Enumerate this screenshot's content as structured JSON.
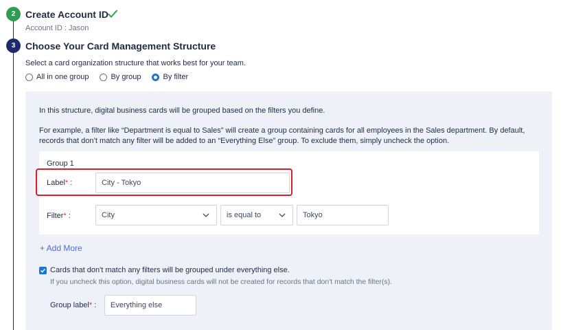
{
  "steps": [
    {
      "number": "2",
      "title": "Create Account ID",
      "status": "complete",
      "detail": "Account ID : Jason"
    },
    {
      "number": "3",
      "title": "Choose Your Card Management Structure",
      "status": "active",
      "description": "Select a card organization structure that works best for your team."
    }
  ],
  "structure_options": [
    {
      "label": "All in one group",
      "selected": false
    },
    {
      "label": "By group",
      "selected": false
    },
    {
      "label": "By filter",
      "selected": true
    }
  ],
  "filter_panel": {
    "intro": "In this structure, digital business cards will be grouped based on the filters you define.",
    "example": "For example, a filter like “Department is equal to Sales” will create a group containing cards for all employees in the Sales department. By default, records that don’t match any filter will be added to an “Everything Else” group. To exclude them, simply uncheck the option.",
    "group": {
      "title": "Group 1",
      "label_field": {
        "label": "Label",
        "required_mark": "*",
        "separator": ":",
        "value": "City - Tokyo"
      },
      "filter_field": {
        "label": "Filter",
        "required_mark": "*",
        "separator": ":",
        "attribute": "City",
        "operator": "is equal to",
        "value": "Tokyo"
      }
    },
    "add_more": "+ Add More",
    "everything_else": {
      "checked": true,
      "label": "Cards that don't match any filters will be grouped under everything else.",
      "help": "If you uncheck this option, digital business cards will not be created for records that don't match the filter(s).",
      "group_label": {
        "label": "Group label",
        "required_mark": "*",
        "separator": ":",
        "value": "Everything else"
      }
    }
  },
  "colors": {
    "complete": "#2e9e4f",
    "active": "#1d2b6b",
    "accent": "#1976d2",
    "highlight": "#d91f26",
    "panel_bg": "#eef1f8",
    "link": "#4f6bd8"
  },
  "icons": {
    "complete_check": "check-icon",
    "select_chevron": "chevron-down-icon"
  }
}
